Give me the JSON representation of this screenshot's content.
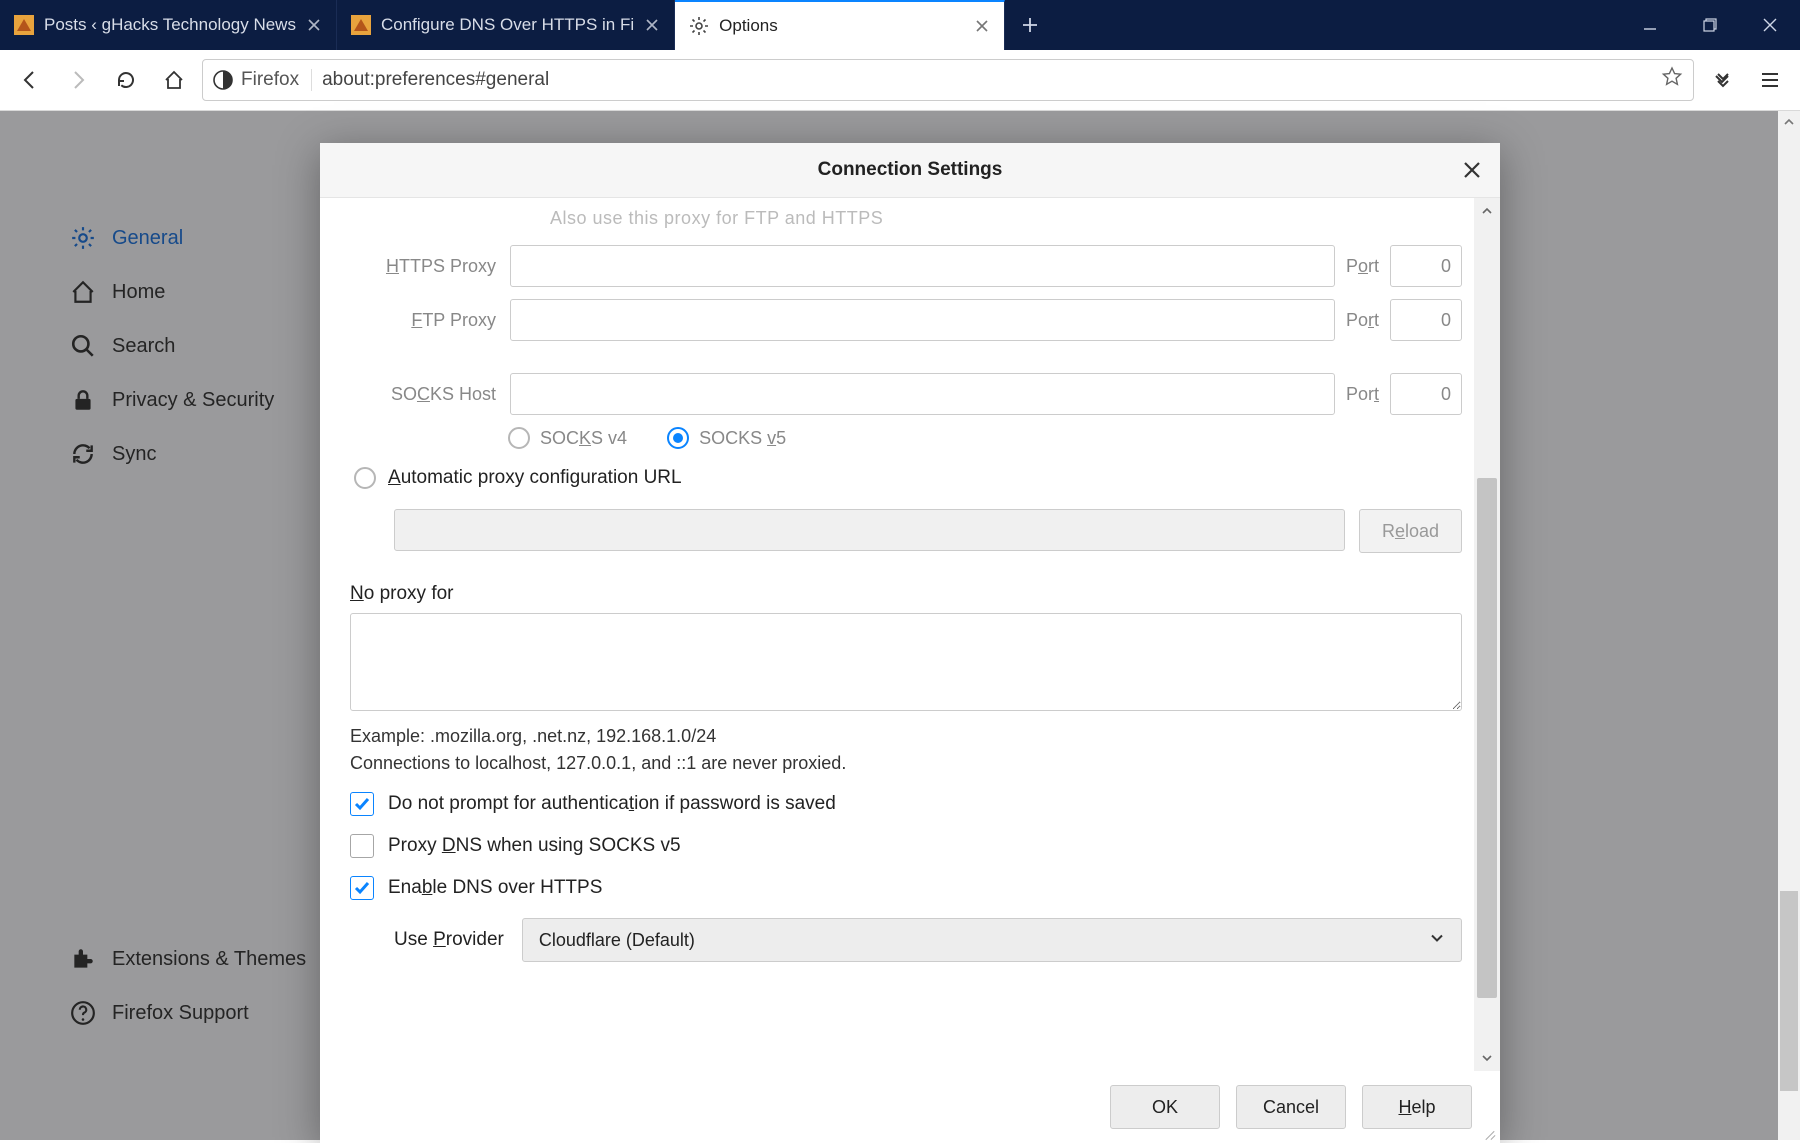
{
  "tabs": [
    {
      "label": "Posts ‹ gHacks Technology News",
      "active": false
    },
    {
      "label": "Configure DNS Over HTTPS in Fi",
      "active": false
    },
    {
      "label": "Options",
      "active": true
    }
  ],
  "url": {
    "identity": "Firefox",
    "value": "about:preferences#general"
  },
  "sidebar": {
    "items": [
      {
        "key": "general",
        "label": "General",
        "selected": true
      },
      {
        "key": "home",
        "label": "Home"
      },
      {
        "key": "search",
        "label": "Search"
      },
      {
        "key": "privacy",
        "label": "Privacy & Security"
      },
      {
        "key": "sync",
        "label": "Sync"
      }
    ],
    "bottom": [
      {
        "key": "ext",
        "label": "Extensions & Themes"
      },
      {
        "key": "support",
        "label": "Firefox Support"
      }
    ]
  },
  "dialog": {
    "title": "Connection Settings",
    "also_proxy_label": "Also use this proxy for FTP and HTTPS",
    "https_label": "HTTPS Proxy",
    "ftp_label": "FTP Proxy",
    "socks_label": "SOCKS Host",
    "port_label": "Port",
    "https_port": "0",
    "ftp_port": "0",
    "socks_port": "0",
    "socks_v4": "SOCKS v4",
    "socks_v5": "SOCKS v5",
    "socks_version_selected": "v5",
    "auto_url_label": "Automatic proxy configuration URL",
    "reload_label": "Reload",
    "no_proxy_label": "No proxy for",
    "example": "Example: .mozilla.org, .net.nz, 192.168.1.0/24",
    "localhost_note": "Connections to localhost, 127.0.0.1, and ::1 are never proxied.",
    "chk_noauth": {
      "label": "Do not prompt for authentication if password is saved",
      "checked": true
    },
    "chk_socksdns": {
      "label": "Proxy DNS when using SOCKS v5",
      "checked": false
    },
    "chk_doh": {
      "label": "Enable DNS over HTTPS",
      "checked": true
    },
    "provider_label": "Use Provider",
    "provider_value": "Cloudflare (Default)",
    "buttons": {
      "ok": "OK",
      "cancel": "Cancel",
      "help": "Help"
    }
  }
}
